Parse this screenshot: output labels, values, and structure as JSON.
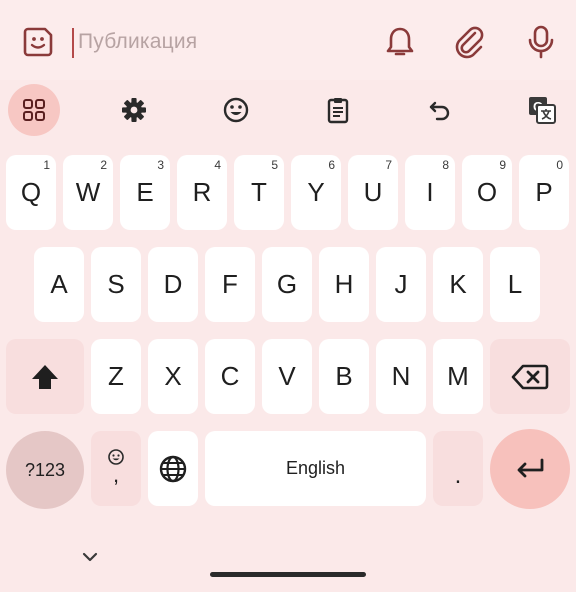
{
  "input": {
    "placeholder": "Публикация"
  },
  "icons": {
    "sticker": "sticker-smile-icon",
    "bell": "bell-icon",
    "attach": "paperclip-icon",
    "mic": "microphone-icon",
    "apps": "apps-grid-icon",
    "settings": "gear-icon",
    "emoji": "emoji-icon",
    "clipboard": "clipboard-icon",
    "undo": "undo-icon",
    "translate": "translate-icon"
  },
  "keyboard": {
    "row1": [
      {
        "label": "Q",
        "hint": "1"
      },
      {
        "label": "W",
        "hint": "2"
      },
      {
        "label": "E",
        "hint": "3"
      },
      {
        "label": "R",
        "hint": "4"
      },
      {
        "label": "T",
        "hint": "5"
      },
      {
        "label": "Y",
        "hint": "6"
      },
      {
        "label": "U",
        "hint": "7"
      },
      {
        "label": "I",
        "hint": "8"
      },
      {
        "label": "O",
        "hint": "9"
      },
      {
        "label": "P",
        "hint": "0"
      }
    ],
    "row2": [
      "A",
      "S",
      "D",
      "F",
      "G",
      "H",
      "J",
      "K",
      "L"
    ],
    "row3": [
      "Z",
      "X",
      "C",
      "V",
      "B",
      "N",
      "M"
    ],
    "symbols_label": "?123",
    "comma_label": ",",
    "period_label": ".",
    "space_label": "English"
  },
  "colors": {
    "background": "#fbe9e9",
    "key": "#ffffff",
    "function_key": "#f8dede",
    "accent": "#f7c1bc",
    "symbols_key": "#e5c7c6",
    "cursor": "#b44a4a"
  }
}
